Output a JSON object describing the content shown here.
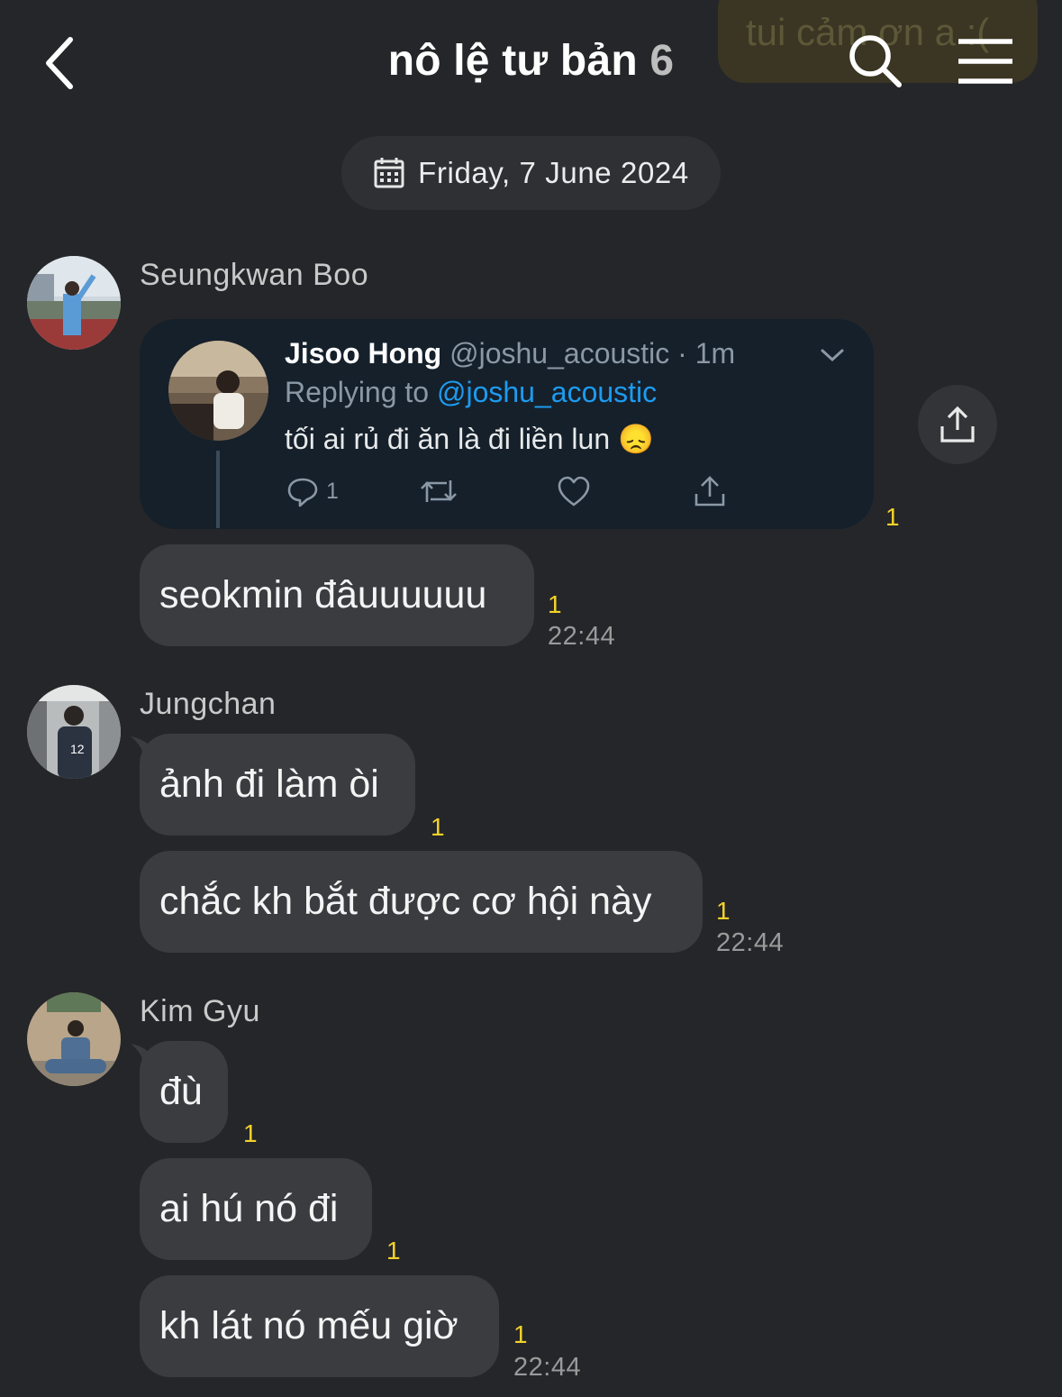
{
  "header": {
    "ghost_message": "tui cảm ơn a :(",
    "title": "nô lệ tư bản",
    "member_count": "6",
    "back_icon": "chevron-left-icon",
    "search_icon": "search-icon",
    "menu_icon": "hamburger-menu-icon"
  },
  "date_divider": {
    "icon": "calendar-icon",
    "label": "Friday, 7 June 2024"
  },
  "groups": [
    {
      "sender": "Seungkwan Boo",
      "tweet": {
        "author": "Jisoo Hong",
        "handle": "@joshu_acoustic · 1m",
        "replying_prefix": "Replying to",
        "replying_handle": "@joshu_acoustic",
        "text": "tối ai rủ đi ăn là đi liền lun 😞",
        "reply_count": "1",
        "unread": "1"
      },
      "messages": [
        {
          "text": "seokmin đâuuuuuu",
          "unread": "1",
          "time": "22:44"
        }
      ]
    },
    {
      "sender": "Jungchan",
      "messages": [
        {
          "text": "ảnh đi làm òi",
          "unread": "1"
        },
        {
          "text": "chắc kh bắt được cơ hội này",
          "unread": "1",
          "time": "22:44"
        }
      ]
    },
    {
      "sender": "Kim Gyu",
      "messages": [
        {
          "text": "đù",
          "unread": "1"
        },
        {
          "text": "ai hú nó đi",
          "unread": "1"
        },
        {
          "text": "kh lát nó mếu giờ",
          "unread": "1",
          "time": "22:44"
        }
      ]
    }
  ],
  "colors": {
    "background": "#252629",
    "bubble": "#3b3c40",
    "unread_badge": "#f3d22a",
    "tweet_card": "#15202b",
    "mention": "#1d9bf0"
  }
}
